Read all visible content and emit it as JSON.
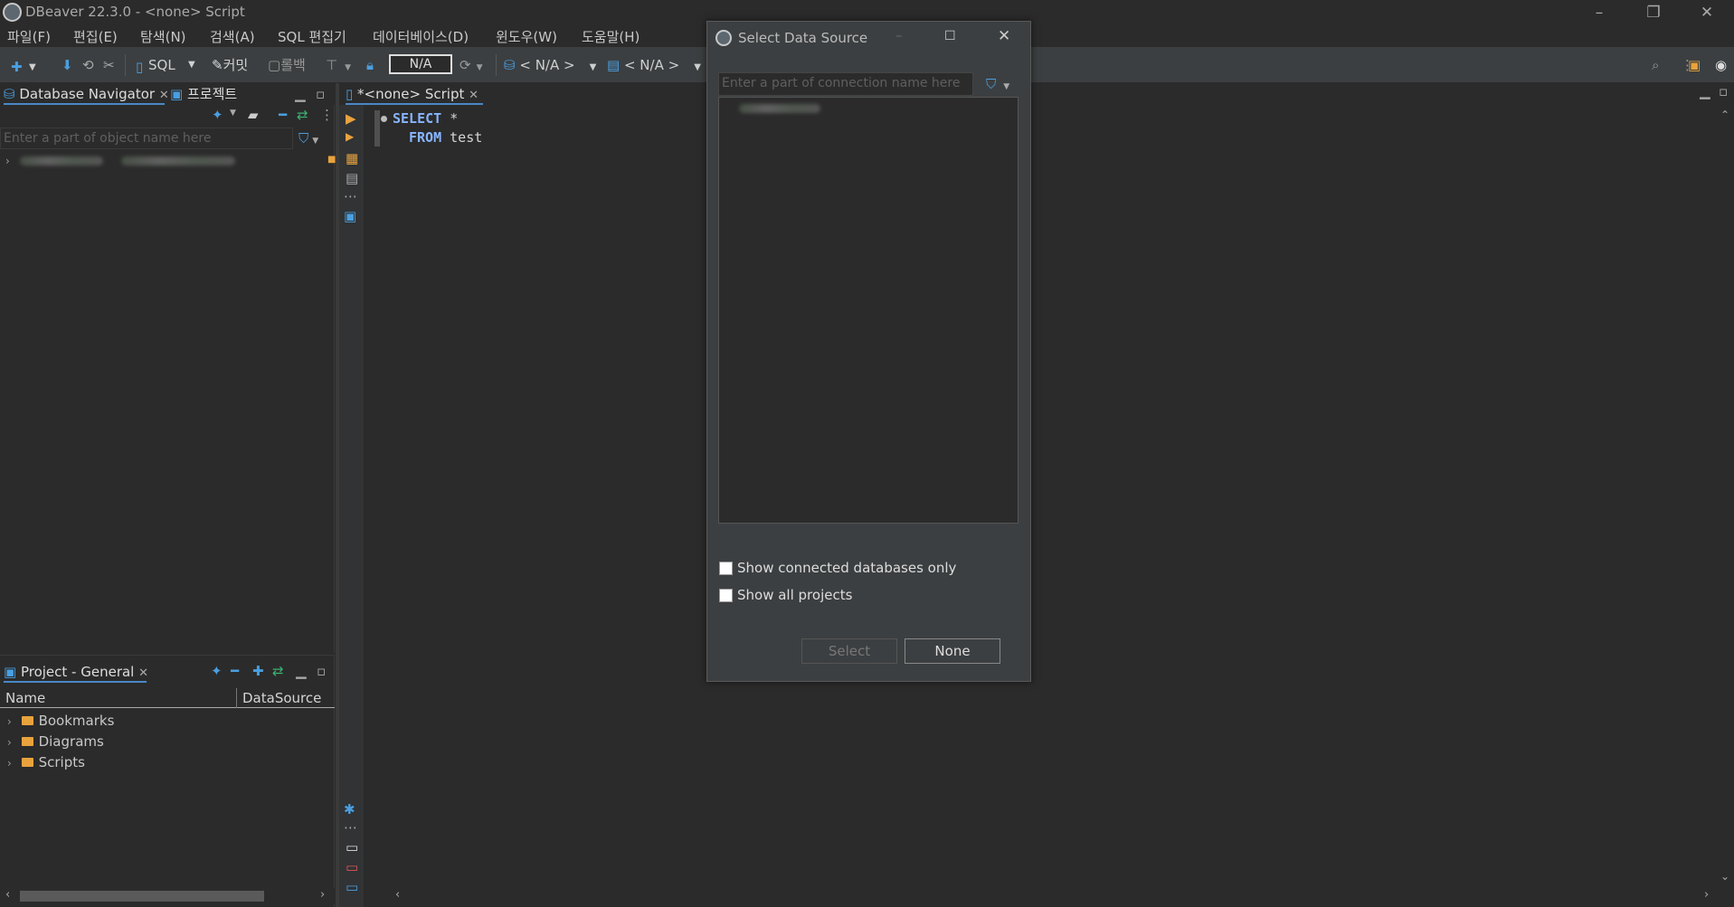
{
  "window": {
    "title": "DBeaver 22.3.0 - <none> Script",
    "minimize_glyph": "–",
    "restore_glyph": "❐",
    "close_glyph": "✕"
  },
  "menu": [
    "파일(F)",
    "편집(E)",
    "탐색(N)",
    "검색(A)",
    "SQL 편집기",
    "데이터베이스(D)",
    "윈도우(W)",
    "도움말(H)"
  ],
  "toolbar": {
    "sql_label": "SQL",
    "commit_label": "커밋",
    "rollback_label": "롤백",
    "transaction_mode": "N/A",
    "datasource": "< N/A >",
    "schema": "< N/A >"
  },
  "navigator": {
    "tab_label": "Database Navigator",
    "projects_tab_label": "프로젝트",
    "filter_placeholder": "Enter a part of object name here"
  },
  "project_panel": {
    "tab_label": "Project - General",
    "columns": [
      "Name",
      "DataSource"
    ],
    "items": [
      "Bookmarks",
      "Diagrams",
      "Scripts"
    ]
  },
  "editor": {
    "tab_label": "*<none> Script",
    "line1_kw": "SELECT",
    "line1_rest": " *",
    "line2_kw": "FROM",
    "line2_rest": " test"
  },
  "dialog": {
    "title": "Select Data Source",
    "filter_placeholder": "Enter a part of connection name here",
    "option_connected_only": "Show connected databases only",
    "option_all_projects": "Show all projects",
    "select_button": "Select",
    "none_button": "None"
  },
  "colors": {
    "accent": "#4a88c7",
    "keyword": "#88b5ff",
    "folder": "#e8a33d"
  }
}
